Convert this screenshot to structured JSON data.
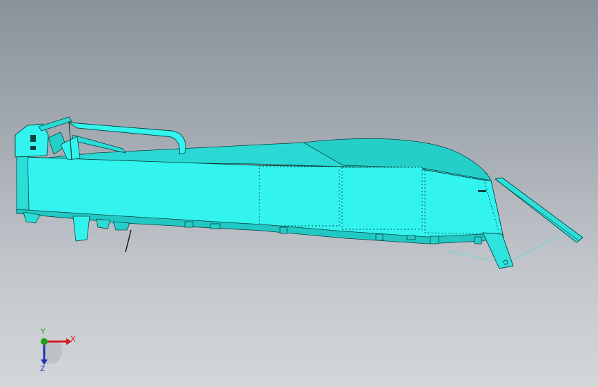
{
  "viewport": {
    "background_top": "#8b929b",
    "background_bottom": "#d3d6da"
  },
  "model": {
    "name": "boat-hull-assembly",
    "body_color": "#33f3ee",
    "shade_color": "#21c9c4",
    "edge_color": "#0a4443"
  },
  "triad": {
    "x_label": "X",
    "y_label": "Y",
    "z_label": "Z",
    "x_color": "#d42020",
    "y_color": "#1fa01f",
    "z_color": "#2430b8"
  }
}
